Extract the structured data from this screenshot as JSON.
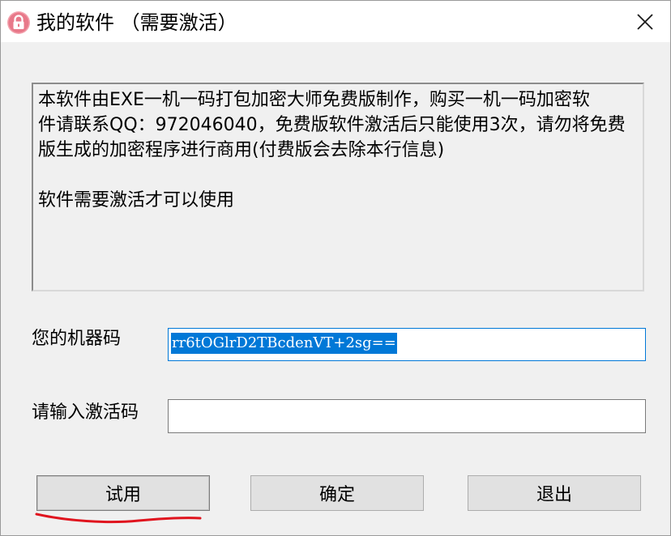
{
  "window": {
    "title": "我的软件 （需要激活）",
    "app_icon": "padlock-icon",
    "close_icon": "close-icon"
  },
  "message": {
    "line1": "本软件由EXE一机一码打包加密大师免费版制作，购买一机一码加密软",
    "line2": "件请联系QQ：972046040，免费版软件激活后只能使用3次，请勿将免费",
    "line3": "版生成的加密程序进行商用(付费版会去除本行信息)",
    "line4": "软件需要激活才可以使用"
  },
  "machine": {
    "label": "您的机器码",
    "value": "rr6tOGlrD2TBcdenVT+2sg=="
  },
  "activation": {
    "label": "请输入激活码",
    "value": ""
  },
  "buttons": {
    "trial": "试用",
    "confirm": "确定",
    "exit": "退出"
  },
  "colors": {
    "selection": "#0078d7",
    "focus_border": "#0078d7",
    "annotation": "#e0141e",
    "icon_bg": "#e8798a"
  }
}
